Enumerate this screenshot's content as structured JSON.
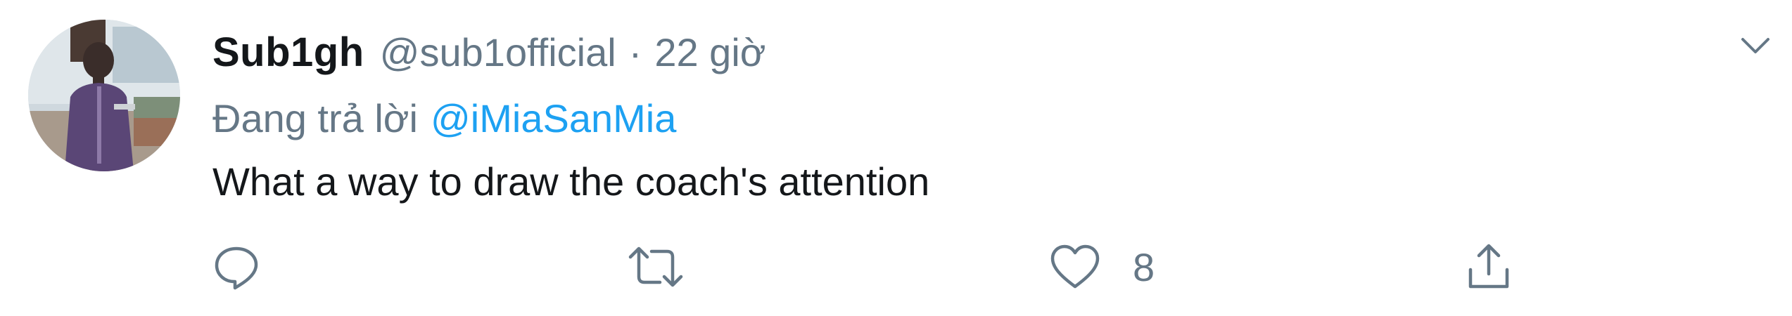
{
  "tweet": {
    "display_name": "Sub1gh",
    "handle": "@sub1official",
    "separator": "·",
    "time": "22 giờ",
    "reply_prefix": "Đang trả lời",
    "reply_mention": "@iMiaSanMia",
    "text": "What a way to draw the coach's attention"
  },
  "actions": {
    "reply_icon": "reply-icon",
    "retweet_icon": "retweet-icon",
    "like_icon": "heart-icon",
    "like_count": "8",
    "share_icon": "share-icon"
  },
  "colors": {
    "text_primary": "#14171a",
    "text_secondary": "#657786",
    "link": "#1da1f2"
  }
}
